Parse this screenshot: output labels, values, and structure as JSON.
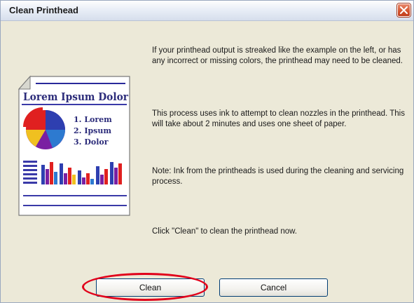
{
  "dialog": {
    "title": "Clean Printhead",
    "paragraphs": [
      "If your printhead output is streaked like the example on the left, or has any incorrect or missing colors, the printhead may need to be cleaned.",
      "This process uses ink to attempt to clean nozzles in the printhead. This will take about 2 minutes and uses one sheet of paper.",
      "Note: Ink from the printheads is used during the cleaning and servicing process.",
      "Click \"Clean\" to clean the printhead now."
    ],
    "buttons": {
      "clean": "Clean",
      "cancel": "Cancel"
    }
  },
  "illustration": {
    "heading": "Lorem Ipsum Dolor",
    "items": [
      "1. Lorem",
      "2. Ipsum",
      "3. Dolor"
    ]
  },
  "colors": {
    "highlight": "#e1001a",
    "close_button": "#d2522c"
  }
}
